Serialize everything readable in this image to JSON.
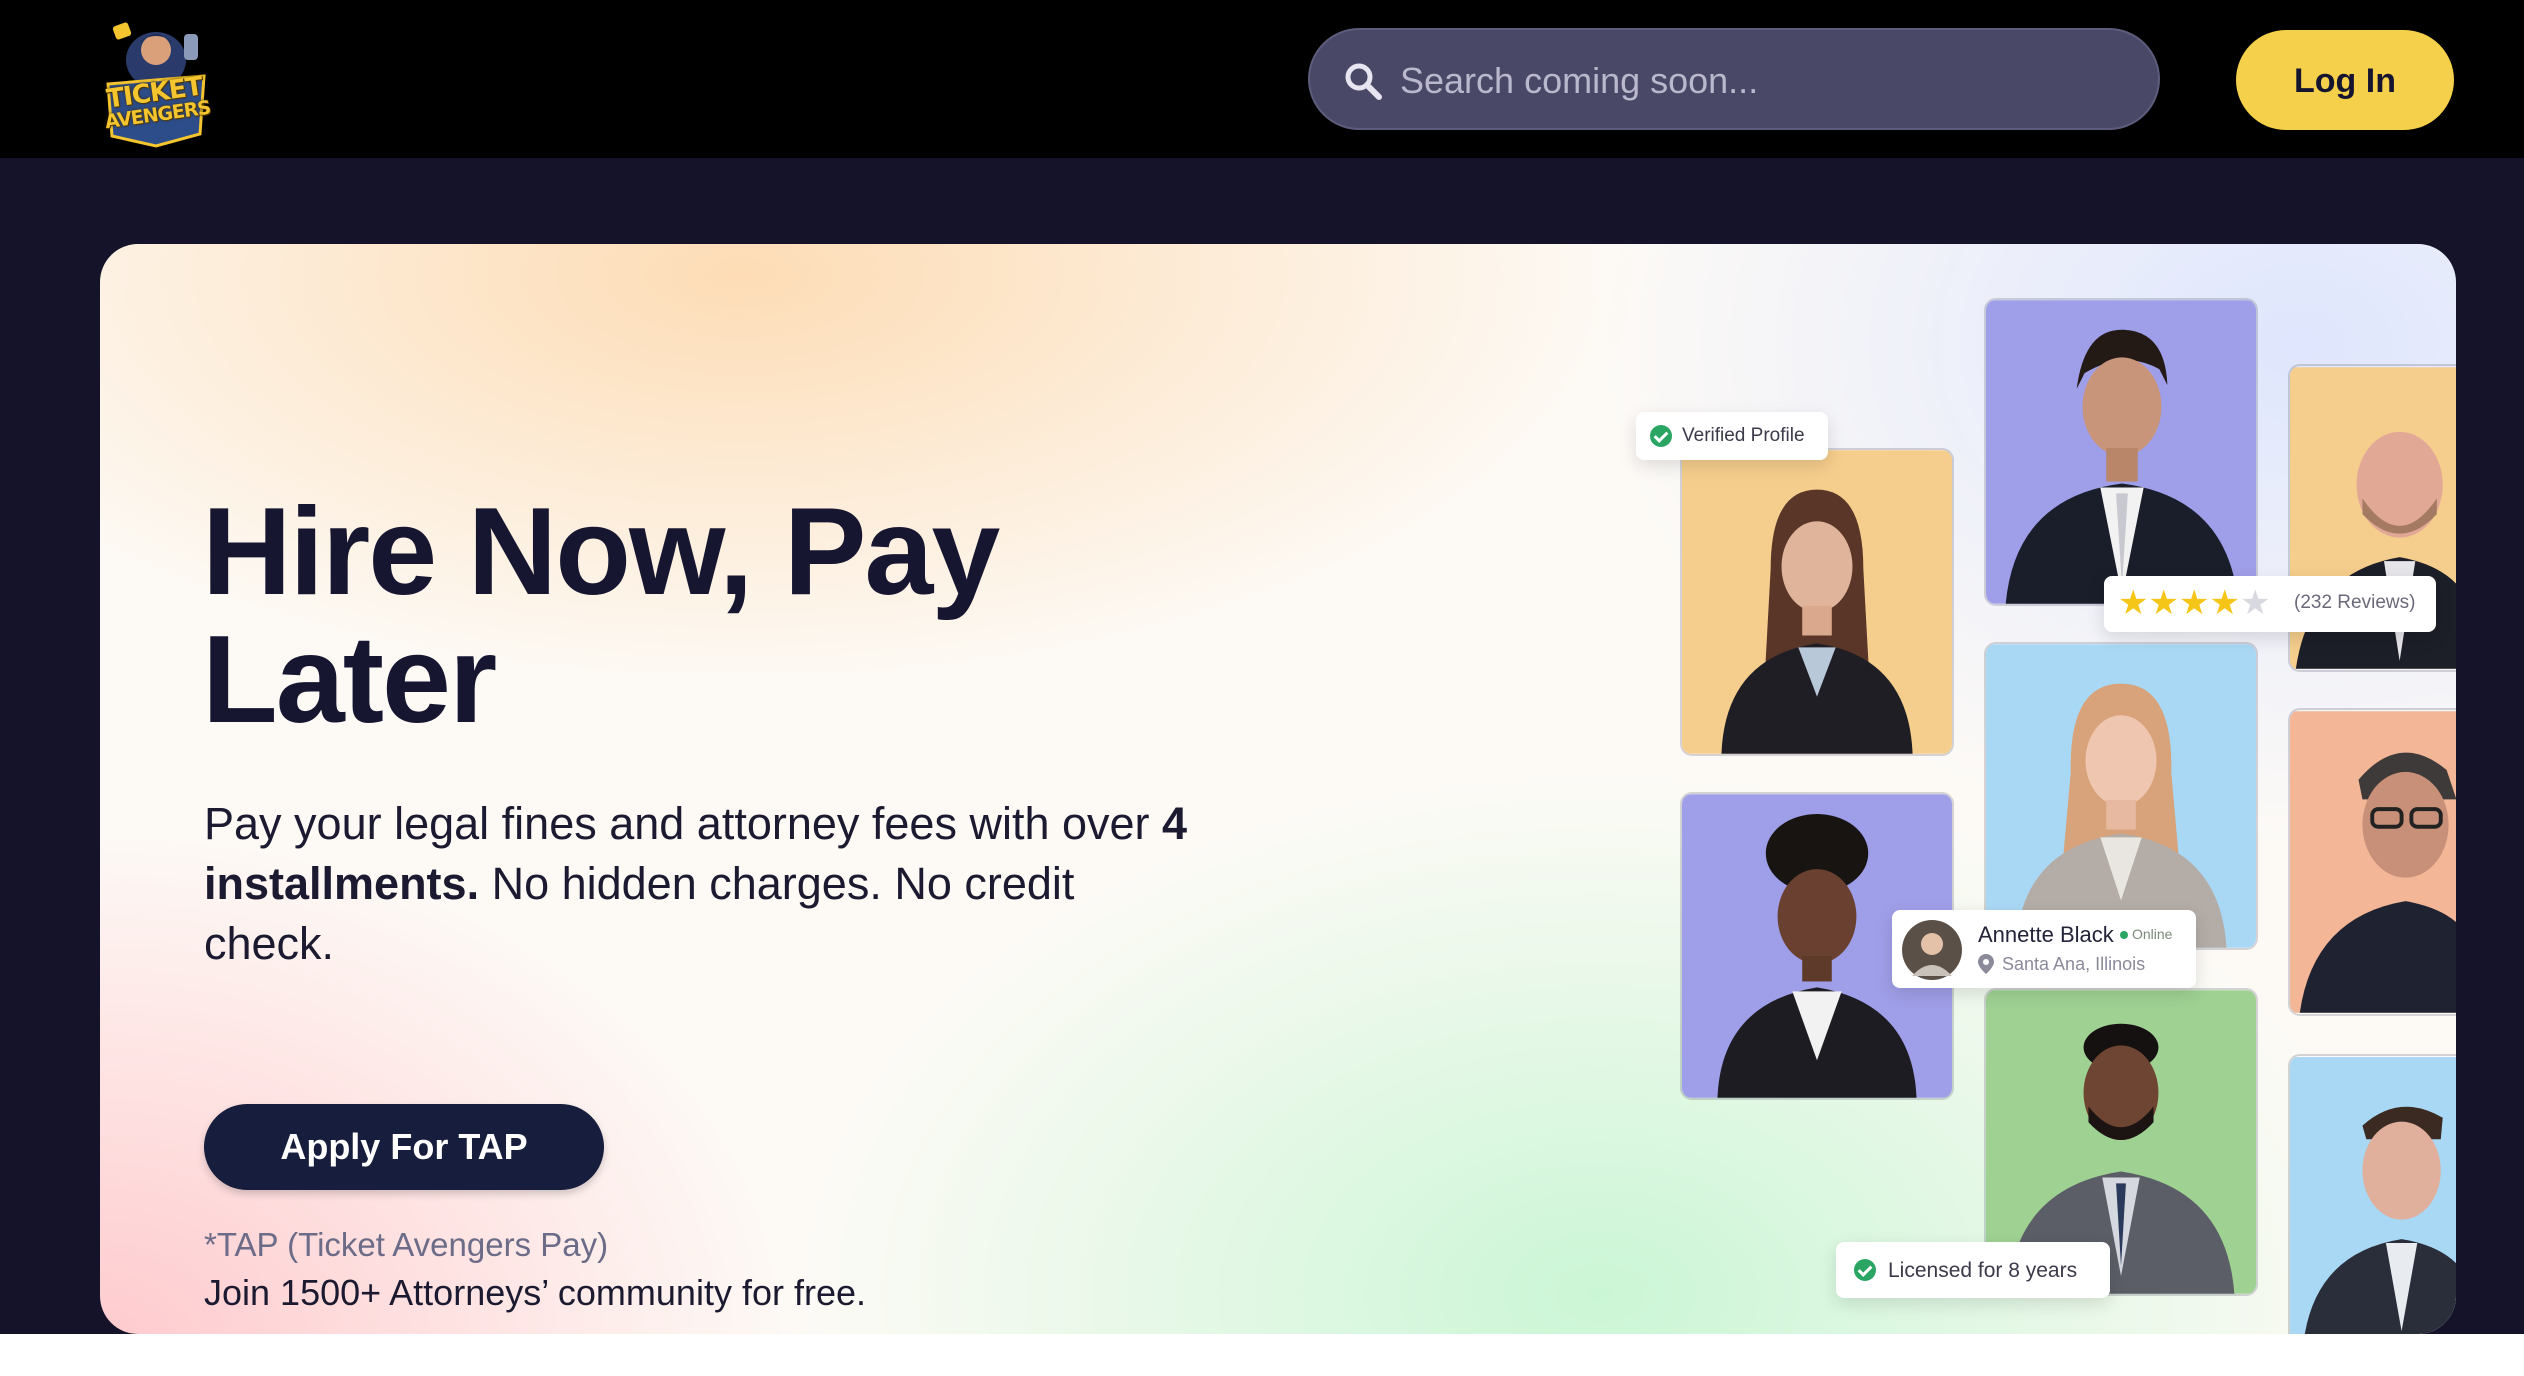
{
  "header": {
    "logo": {
      "line1": "TICKET",
      "line2": "AVENGERS",
      "alt": "Ticket Avengers logo"
    },
    "search": {
      "placeholder": "Search coming soon..."
    },
    "login_label": "Log In"
  },
  "hero": {
    "headline": "Hire Now, Pay Later",
    "sub_pre": "Pay your legal fines and attorney fees with over ",
    "sub_bold": "4 installments.",
    "sub_post": " No hidden charges. No credit check.",
    "apply_label": "Apply For TAP",
    "tap_note": "*TAP (Ticket Avengers Pay)",
    "join_text": "Join 1500+ Attorneys’ community for free."
  },
  "badges": {
    "verified": "Verified Profile",
    "reviews": "(232 Reviews)",
    "rating": 4,
    "rating_max": 5,
    "attorney_name": "Annette Black",
    "status": "Online",
    "location": "Santa Ana, Illinois",
    "licensed": "Licensed for 8 years"
  },
  "colors": {
    "accent_yellow": "#f5d04a",
    "dark_navy": "#171d3c",
    "green": "#2aa564"
  }
}
